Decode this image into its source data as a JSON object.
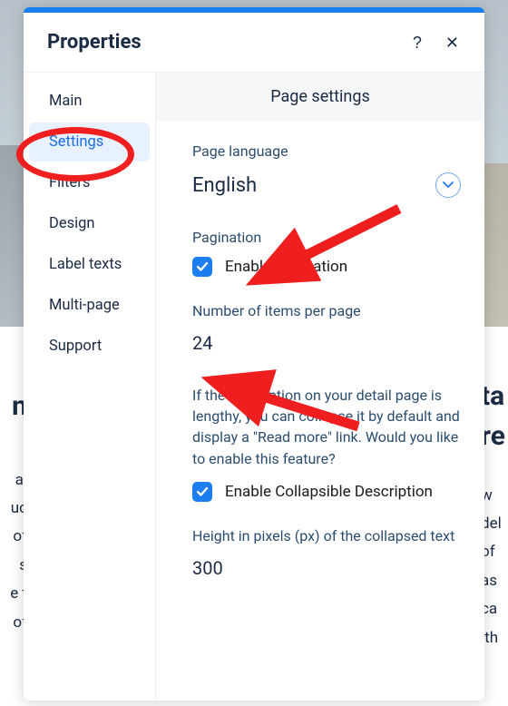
{
  "header": {
    "title": "Properties",
    "help_glyph": "?",
    "close_glyph": "✕"
  },
  "sidebar": {
    "items": [
      {
        "label": "Main"
      },
      {
        "label": "Settings",
        "active": true
      },
      {
        "label": "Filters"
      },
      {
        "label": "Design"
      },
      {
        "label": "Label texts"
      },
      {
        "label": "Multi-page"
      },
      {
        "label": "Support"
      }
    ]
  },
  "content": {
    "panel_title": "Page settings",
    "language": {
      "label": "Page language",
      "value": "English"
    },
    "pagination": {
      "section_label": "Pagination",
      "enable_label": "Enable pagination",
      "enabled": true,
      "items_per_page_label": "Number of items per page",
      "items_per_page_value": "24"
    },
    "collapsible": {
      "description": "If the description on your detail page is lengthy, you can collapse it by default and display a \"Read more\" link. Would you like to enable this feature?",
      "enable_label": "Enable Collapsible Description",
      "enabled": true,
      "height_label": "Height in pixels (px) of the collapsed text",
      "height_value": "300"
    }
  },
  "bg": {
    "left_heading_fragment": "n",
    "right_heading_fragment": "ta",
    "right_heading_line2": "re",
    "left_lines": [
      "al",
      "uc",
      "of",
      " s",
      "e t",
      "of"
    ],
    "right_lines": [
      " w",
      "del",
      " of",
      "as",
      " ca",
      "ith"
    ]
  },
  "colors": {
    "accent": "#1a7df0",
    "annotation": "#ef1f1f",
    "text_dark": "#1b2b44",
    "text_muted": "#2c4d6e"
  }
}
